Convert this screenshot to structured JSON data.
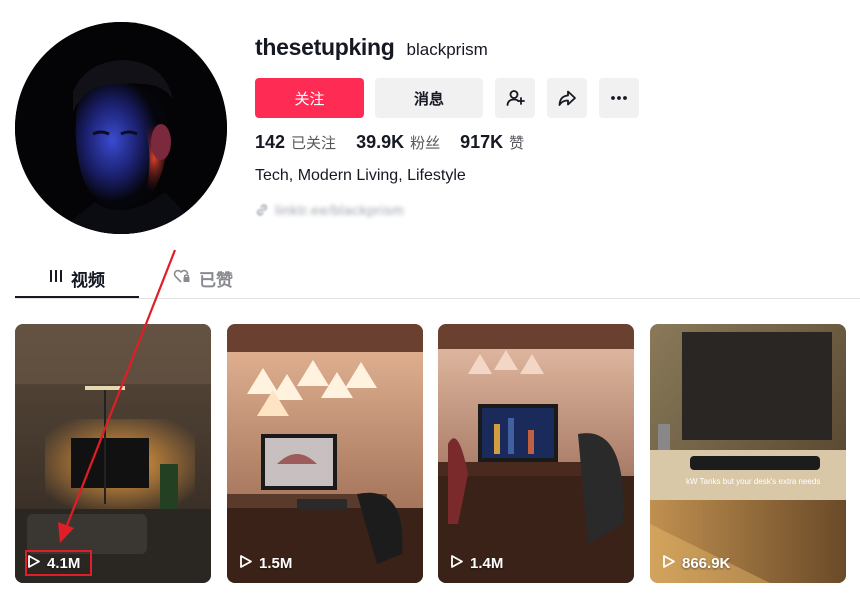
{
  "profile": {
    "username": "thesetupking",
    "nickname": "blackprism",
    "bio": "Tech, Modern Living, Lifestyle",
    "link_text": "linktr.ee/blackprism"
  },
  "actions": {
    "follow_label": "关注",
    "message_label": "消息",
    "add_friend_icon": "add-person-icon",
    "share_icon": "share-icon",
    "more_icon": "more-icon"
  },
  "stats": [
    {
      "value": "142",
      "label": "已关注"
    },
    {
      "value": "39.9K",
      "label": "粉丝"
    },
    {
      "value": "917K",
      "label": "赞"
    }
  ],
  "tabs": {
    "videos": "视频",
    "liked": "已赞"
  },
  "videos": [
    {
      "views": "4.1M"
    },
    {
      "views": "1.5M"
    },
    {
      "views": "1.4M"
    },
    {
      "views": "866.9K",
      "overlay": "kW Tanks but your desk's extra needs"
    }
  ],
  "colors": {
    "accent": "#fe2c55",
    "annotation": "#e11d27"
  }
}
